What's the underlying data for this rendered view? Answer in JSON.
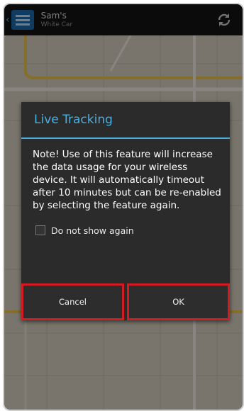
{
  "header": {
    "title": "Sam's",
    "subtitle": "White Car",
    "back_icon": "chevron-left-icon",
    "app_icon": "menu-icon",
    "refresh_icon": "refresh-icon"
  },
  "dialog": {
    "title": "Live Tracking",
    "message": "Note! Use of this feature will increase the data usage for your wireless device. It will automatically timeout after 10 minutes but can be re-enabled by selecting the feature again.",
    "checkbox_label": "Do not show again",
    "checkbox_checked": false,
    "cancel_label": "Cancel",
    "ok_label": "OK",
    "accent_color": "#48b0e0",
    "highlight_color": "#d21c24"
  }
}
